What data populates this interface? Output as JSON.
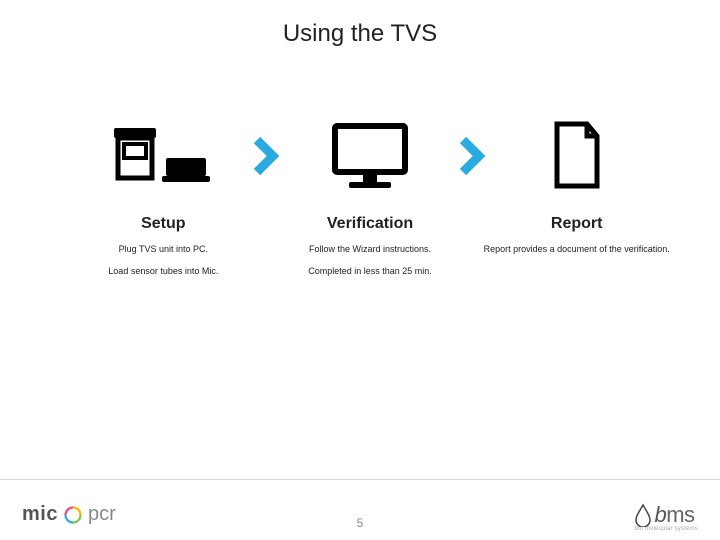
{
  "title": "Using the TVS",
  "steps": [
    {
      "heading": "Setup",
      "lines": [
        "Plug TVS unit into PC.",
        "Load sensor tubes into Mic."
      ]
    },
    {
      "heading": "Verification",
      "lines": [
        "Follow the Wizard instructions.",
        "Completed in less than 25 min."
      ]
    },
    {
      "heading": "Report",
      "lines": [
        "Report provides a document of the verification."
      ]
    }
  ],
  "footer": {
    "left_brand_a": "mic",
    "left_brand_b": "pcr",
    "page": "5",
    "right_brand": "bms",
    "right_tagline": "bio molecular systems"
  },
  "colors": {
    "accent": "#29abe2"
  }
}
